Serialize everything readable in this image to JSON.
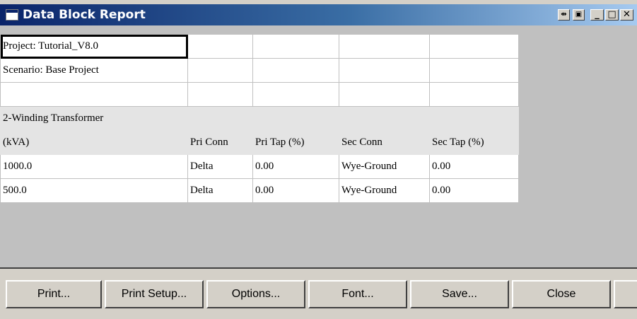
{
  "window": {
    "title": "Data Block Report",
    "icons": [
      "app-window-icon",
      "pin-icon",
      "restore-icon",
      "minimize-icon",
      "maximize-icon",
      "close-icon"
    ],
    "controls": {
      "pin": "⇹",
      "restore": "▣",
      "minimize": "_",
      "maximize": "□",
      "close": "✕"
    },
    "title_gradient": [
      "#0a246a",
      "#a6caf0"
    ]
  },
  "grid": {
    "rows": [
      {
        "style": "white",
        "cells": [
          "Project: Tutorial_V8.0",
          "",
          "",
          "",
          ""
        ]
      },
      {
        "style": "white",
        "cells": [
          "Scenario: Base Project",
          "",
          "",
          "",
          ""
        ]
      },
      {
        "style": "white",
        "cells": [
          "",
          "",
          "",
          "",
          ""
        ]
      },
      {
        "style": "gray",
        "cells": [
          "2-Winding Transformer",
          "",
          "",
          "",
          ""
        ]
      },
      {
        "style": "gray",
        "cells": [
          "(kVA)",
          "Pri Conn",
          "Pri Tap (%)",
          "Sec Conn",
          "Sec Tap (%)"
        ]
      },
      {
        "style": "white",
        "cells": [
          "1000.0",
          "Delta",
          "0.00",
          "Wye-Ground",
          "0.00"
        ]
      },
      {
        "style": "white",
        "cells": [
          "500.0",
          "Delta",
          "0.00",
          "Wye-Ground",
          "0.00"
        ]
      }
    ],
    "selected_cell": "Project: Tutorial_V8.0"
  },
  "buttons": {
    "print": "Print...",
    "print_setup": "Print Setup...",
    "options": "Options...",
    "font": "Font...",
    "save": "Save...",
    "close": "Close"
  }
}
